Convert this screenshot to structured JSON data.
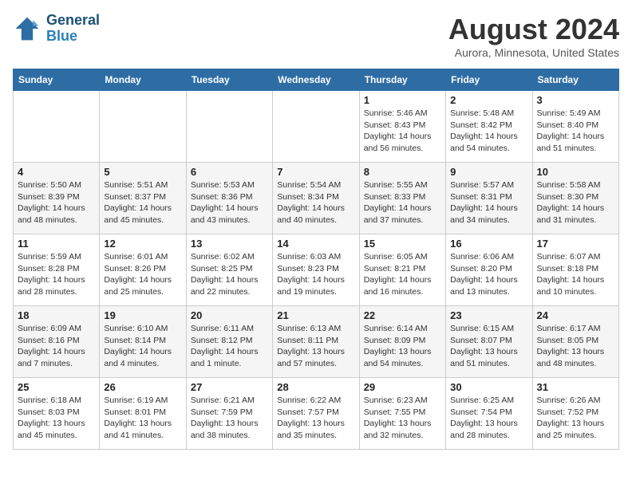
{
  "header": {
    "logo_line1": "General",
    "logo_line2": "Blue",
    "month_year": "August 2024",
    "location": "Aurora, Minnesota, United States"
  },
  "weekdays": [
    "Sunday",
    "Monday",
    "Tuesday",
    "Wednesday",
    "Thursday",
    "Friday",
    "Saturday"
  ],
  "weeks": [
    [
      {
        "day": "",
        "info": ""
      },
      {
        "day": "",
        "info": ""
      },
      {
        "day": "",
        "info": ""
      },
      {
        "day": "",
        "info": ""
      },
      {
        "day": "1",
        "info": "Sunrise: 5:46 AM\nSunset: 8:43 PM\nDaylight: 14 hours\nand 56 minutes."
      },
      {
        "day": "2",
        "info": "Sunrise: 5:48 AM\nSunset: 8:42 PM\nDaylight: 14 hours\nand 54 minutes."
      },
      {
        "day": "3",
        "info": "Sunrise: 5:49 AM\nSunset: 8:40 PM\nDaylight: 14 hours\nand 51 minutes."
      }
    ],
    [
      {
        "day": "4",
        "info": "Sunrise: 5:50 AM\nSunset: 8:39 PM\nDaylight: 14 hours\nand 48 minutes."
      },
      {
        "day": "5",
        "info": "Sunrise: 5:51 AM\nSunset: 8:37 PM\nDaylight: 14 hours\nand 45 minutes."
      },
      {
        "day": "6",
        "info": "Sunrise: 5:53 AM\nSunset: 8:36 PM\nDaylight: 14 hours\nand 43 minutes."
      },
      {
        "day": "7",
        "info": "Sunrise: 5:54 AM\nSunset: 8:34 PM\nDaylight: 14 hours\nand 40 minutes."
      },
      {
        "day": "8",
        "info": "Sunrise: 5:55 AM\nSunset: 8:33 PM\nDaylight: 14 hours\nand 37 minutes."
      },
      {
        "day": "9",
        "info": "Sunrise: 5:57 AM\nSunset: 8:31 PM\nDaylight: 14 hours\nand 34 minutes."
      },
      {
        "day": "10",
        "info": "Sunrise: 5:58 AM\nSunset: 8:30 PM\nDaylight: 14 hours\nand 31 minutes."
      }
    ],
    [
      {
        "day": "11",
        "info": "Sunrise: 5:59 AM\nSunset: 8:28 PM\nDaylight: 14 hours\nand 28 minutes."
      },
      {
        "day": "12",
        "info": "Sunrise: 6:01 AM\nSunset: 8:26 PM\nDaylight: 14 hours\nand 25 minutes."
      },
      {
        "day": "13",
        "info": "Sunrise: 6:02 AM\nSunset: 8:25 PM\nDaylight: 14 hours\nand 22 minutes."
      },
      {
        "day": "14",
        "info": "Sunrise: 6:03 AM\nSunset: 8:23 PM\nDaylight: 14 hours\nand 19 minutes."
      },
      {
        "day": "15",
        "info": "Sunrise: 6:05 AM\nSunset: 8:21 PM\nDaylight: 14 hours\nand 16 minutes."
      },
      {
        "day": "16",
        "info": "Sunrise: 6:06 AM\nSunset: 8:20 PM\nDaylight: 14 hours\nand 13 minutes."
      },
      {
        "day": "17",
        "info": "Sunrise: 6:07 AM\nSunset: 8:18 PM\nDaylight: 14 hours\nand 10 minutes."
      }
    ],
    [
      {
        "day": "18",
        "info": "Sunrise: 6:09 AM\nSunset: 8:16 PM\nDaylight: 14 hours\nand 7 minutes."
      },
      {
        "day": "19",
        "info": "Sunrise: 6:10 AM\nSunset: 8:14 PM\nDaylight: 14 hours\nand 4 minutes."
      },
      {
        "day": "20",
        "info": "Sunrise: 6:11 AM\nSunset: 8:12 PM\nDaylight: 14 hours\nand 1 minute."
      },
      {
        "day": "21",
        "info": "Sunrise: 6:13 AM\nSunset: 8:11 PM\nDaylight: 13 hours\nand 57 minutes."
      },
      {
        "day": "22",
        "info": "Sunrise: 6:14 AM\nSunset: 8:09 PM\nDaylight: 13 hours\nand 54 minutes."
      },
      {
        "day": "23",
        "info": "Sunrise: 6:15 AM\nSunset: 8:07 PM\nDaylight: 13 hours\nand 51 minutes."
      },
      {
        "day": "24",
        "info": "Sunrise: 6:17 AM\nSunset: 8:05 PM\nDaylight: 13 hours\nand 48 minutes."
      }
    ],
    [
      {
        "day": "25",
        "info": "Sunrise: 6:18 AM\nSunset: 8:03 PM\nDaylight: 13 hours\nand 45 minutes."
      },
      {
        "day": "26",
        "info": "Sunrise: 6:19 AM\nSunset: 8:01 PM\nDaylight: 13 hours\nand 41 minutes."
      },
      {
        "day": "27",
        "info": "Sunrise: 6:21 AM\nSunset: 7:59 PM\nDaylight: 13 hours\nand 38 minutes."
      },
      {
        "day": "28",
        "info": "Sunrise: 6:22 AM\nSunset: 7:57 PM\nDaylight: 13 hours\nand 35 minutes."
      },
      {
        "day": "29",
        "info": "Sunrise: 6:23 AM\nSunset: 7:55 PM\nDaylight: 13 hours\nand 32 minutes."
      },
      {
        "day": "30",
        "info": "Sunrise: 6:25 AM\nSunset: 7:54 PM\nDaylight: 13 hours\nand 28 minutes."
      },
      {
        "day": "31",
        "info": "Sunrise: 6:26 AM\nSunset: 7:52 PM\nDaylight: 13 hours\nand 25 minutes."
      }
    ]
  ]
}
